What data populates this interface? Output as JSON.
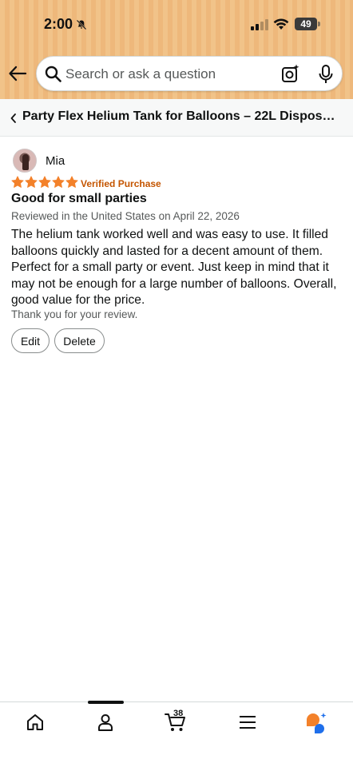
{
  "status_bar": {
    "time": "2:00",
    "battery": "49"
  },
  "search": {
    "placeholder": "Search or ask a question"
  },
  "breadcrumb": {
    "title": "Party Flex Helium Tank for Balloons – 22L Disposable H..."
  },
  "review": {
    "reviewer_name": "Mia",
    "rating": 5,
    "rating_max": 5,
    "verified_label": "Verified Purchase",
    "title": "Good for small parties",
    "meta": "Reviewed in the United States on April 22, 2026",
    "body": "The helium tank worked well and was easy to use. It filled balloons quickly and lasted for a decent amount of them. Perfect for a small party or event. Just keep in mind that it may not be enough for a large number of balloons. Overall, good value for the price.",
    "thanks": "Thank you for your review.",
    "edit_label": "Edit",
    "delete_label": "Delete"
  },
  "bottom_nav": {
    "items": [
      {
        "icon": "home-icon"
      },
      {
        "icon": "account-icon"
      },
      {
        "icon": "cart-icon",
        "count": "38"
      },
      {
        "icon": "menu-icon"
      },
      {
        "icon": "rufus-icon"
      }
    ]
  },
  "colors": {
    "header_bg": "#f1c389",
    "star": "#f3812a",
    "verified": "#c45500",
    "rufus_orange": "#f3812a",
    "rufus_blue": "#1f6feb"
  }
}
